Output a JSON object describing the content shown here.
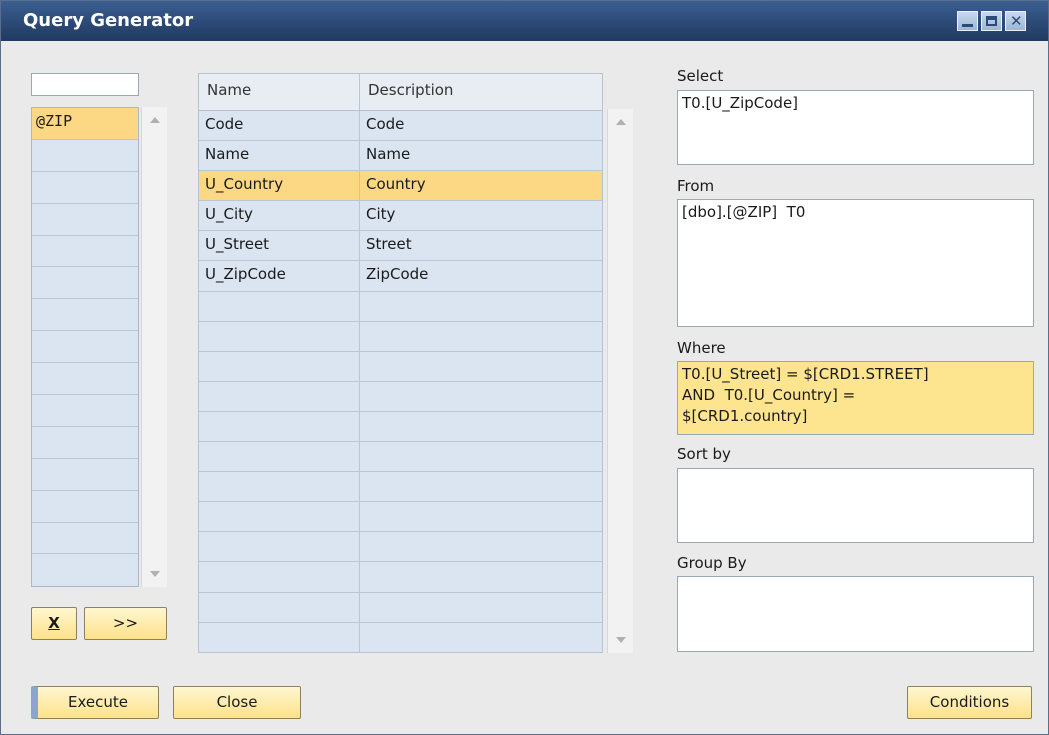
{
  "window": {
    "title": "Query Generator"
  },
  "tables": {
    "filter_value": "",
    "items": [
      "@ZIP"
    ]
  },
  "buttons": {
    "remove": "X",
    "add": ">>",
    "execute": "Execute",
    "close": "Close",
    "conditions": "Conditions"
  },
  "fields": {
    "headers": [
      "Name",
      "Description"
    ],
    "rows": [
      {
        "name": "Code",
        "description": "Code"
      },
      {
        "name": "Name",
        "description": "Name"
      },
      {
        "name": "U_Country",
        "description": "Country"
      },
      {
        "name": "U_City",
        "description": "City"
      },
      {
        "name": "U_Street",
        "description": "Street"
      },
      {
        "name": "U_ZipCode",
        "description": "ZipCode"
      }
    ]
  },
  "query": {
    "select_label": "Select",
    "select_value": "T0.[U_ZipCode]",
    "from_label": "From",
    "from_value": "[dbo].[@ZIP]  T0",
    "where_label": "Where",
    "where_value": "T0.[U_Street] = $[CRD1.STREET]\nAND  T0.[U_Country] =\n$[CRD1.country]",
    "sortby_label": "Sort by",
    "sortby_value": "",
    "groupby_label": "Group By",
    "groupby_value": ""
  },
  "colors": {
    "title_bar": "#2c4a76",
    "selection": "#fdd884",
    "grid_row": "#dbe5f1",
    "button": "#fde28a"
  }
}
